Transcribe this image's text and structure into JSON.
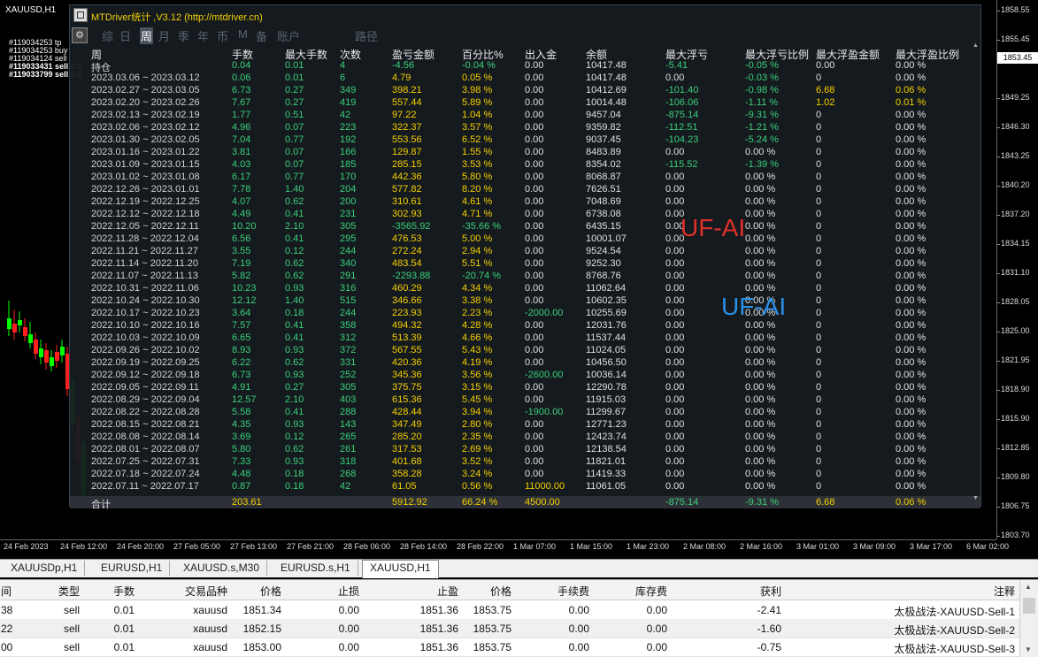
{
  "chart": {
    "symbol_label": "XAUUSD,H1",
    "trade_tags": [
      "#119034253 tp",
      "#119034253 buy",
      "#119034124 sell",
      "#119033431 sell 0.0",
      "#119033799 sell 0.0"
    ],
    "price_ticks": [
      "1858.55",
      "1855.45",
      "1852.35",
      "1849.25",
      "1846.30",
      "1843.25",
      "1840.20",
      "1837.20",
      "1834.15",
      "1831.10",
      "1828.05",
      "1825.00",
      "1821.95",
      "1818.90",
      "1815.90",
      "1812.85",
      "1809.80",
      "1806.75",
      "1803.70"
    ],
    "current_price": "1853.45",
    "time_ticks": [
      "24 Feb 2023",
      "24 Feb 12:00",
      "24 Feb 20:00",
      "27 Feb 05:00",
      "27 Feb 13:00",
      "27 Feb 21:00",
      "28 Feb 06:00",
      "28 Feb 14:00",
      "28 Feb 22:00",
      "1 Mar 07:00",
      "1 Mar 15:00",
      "1 Mar 23:00",
      "2 Mar 08:00",
      "2 Mar 16:00",
      "3 Mar 01:00",
      "3 Mar 09:00",
      "3 Mar 17:00",
      "6 Mar 02:00"
    ],
    "colors": {
      "bull": "#00ff00",
      "bear": "#ff2020",
      "background": "#000000"
    }
  },
  "chart_tabs": [
    "XAUUSDp,H1",
    "EURUSD,H1",
    "XAUUSD.s,M30",
    "EURUSD.s,H1",
    "XAUUSD,H1"
  ],
  "panel": {
    "title": "MTDriver统计 ,V3.12 (http://mtdriver.cn)",
    "settings_glyph": "⚙",
    "tabs": [
      "综",
      "日",
      "周",
      "月",
      "季",
      "年",
      "币",
      "M",
      "备",
      "账户",
      "路径"
    ],
    "active_tab": "周",
    "headers": [
      "周",
      "手数",
      "最大手数",
      "次数",
      "盈亏金额",
      "百分比%",
      "出入金",
      "余额",
      "最大浮亏",
      "最大浮亏比例",
      "最大浮盈金额",
      "最大浮盈比例"
    ],
    "position_row": [
      "持仓",
      "0.04",
      "0.01",
      "4",
      "-4.56",
      "-0.04 %",
      "0.00",
      "10417.48",
      "-5.41",
      "-0.05 %",
      "0.00",
      "0.00 %"
    ],
    "rows": [
      [
        "2023.03.06 ~ 2023.03.12",
        "0.06",
        "0.01",
        "6",
        "4.79",
        "0.05 %",
        "0.00",
        "10417.48",
        "0.00",
        "-0.03 %",
        "0",
        "0.00 %"
      ],
      [
        "2023.02.27 ~ 2023.03.05",
        "6.73",
        "0.27",
        "349",
        "398.21",
        "3.98 %",
        "0.00",
        "10412.69",
        "-101.40",
        "-0.98 %",
        "6.68",
        "0.06 %"
      ],
      [
        "2023.02.20 ~ 2023.02.26",
        "7.67",
        "0.27",
        "419",
        "557.44",
        "5.89 %",
        "0.00",
        "10014.48",
        "-106.06",
        "-1.11 %",
        "1.02",
        "0.01 %"
      ],
      [
        "2023.02.13 ~ 2023.02.19",
        "1.77",
        "0.51",
        "42",
        "97.22",
        "1.04 %",
        "0.00",
        "9457.04",
        "-875.14",
        "-9.31 %",
        "0",
        "0.00 %"
      ],
      [
        "2023.02.06 ~ 2023.02.12",
        "4.96",
        "0.07",
        "223",
        "322.37",
        "3.57 %",
        "0.00",
        "9359.82",
        "-112.51",
        "-1.21 %",
        "0",
        "0.00 %"
      ],
      [
        "2023.01.30 ~ 2023.02.05",
        "7.04",
        "0.77",
        "192",
        "553.56",
        "6.52 %",
        "0.00",
        "9037.45",
        "-104.23",
        "-5.24 %",
        "0",
        "0.00 %"
      ],
      [
        "2023.01.16 ~ 2023.01.22",
        "3.81",
        "0.07",
        "166",
        "129.87",
        "1.55 %",
        "0.00",
        "8483.89",
        "0.00",
        "0.00 %",
        "0",
        "0.00 %"
      ],
      [
        "2023.01.09 ~ 2023.01.15",
        "4.03",
        "0.07",
        "185",
        "285.15",
        "3.53 %",
        "0.00",
        "8354.02",
        "-115.52",
        "-1.39 %",
        "0",
        "0.00 %"
      ],
      [
        "2023.01.02 ~ 2023.01.08",
        "6.17",
        "0.77",
        "170",
        "442.36",
        "5.80 %",
        "0.00",
        "8068.87",
        "0.00",
        "0.00 %",
        "0",
        "0.00 %"
      ],
      [
        "2022.12.26 ~ 2023.01.01",
        "7.78",
        "1.40",
        "204",
        "577.82",
        "8.20 %",
        "0.00",
        "7626.51",
        "0.00",
        "0.00 %",
        "0",
        "0.00 %"
      ],
      [
        "2022.12.19 ~ 2022.12.25",
        "4.07",
        "0.62",
        "200",
        "310.61",
        "4.61 %",
        "0.00",
        "7048.69",
        "0.00",
        "0.00 %",
        "0",
        "0.00 %"
      ],
      [
        "2022.12.12 ~ 2022.12.18",
        "4.49",
        "0.41",
        "231",
        "302.93",
        "4.71 %",
        "0.00",
        "6738.08",
        "0.00",
        "0.00 %",
        "0",
        "0.00 %"
      ],
      [
        "2022.12.05 ~ 2022.12.11",
        "10.20",
        "2.10",
        "305",
        "-3565.92",
        "-35.66 %",
        "0.00",
        "6435.15",
        "0.00",
        "0.00 %",
        "0",
        "0.00 %"
      ],
      [
        "2022.11.28 ~ 2022.12.04",
        "6.56",
        "0.41",
        "295",
        "476.53",
        "5.00 %",
        "0.00",
        "10001.07",
        "0.00",
        "0.00 %",
        "0",
        "0.00 %"
      ],
      [
        "2022.11.21 ~ 2022.11.27",
        "3.55",
        "0.12",
        "244",
        "272.24",
        "2.94 %",
        "0.00",
        "9524.54",
        "0.00",
        "0.00 %",
        "0",
        "0.00 %"
      ],
      [
        "2022.11.14 ~ 2022.11.20",
        "7.19",
        "0.62",
        "340",
        "483.54",
        "5.51 %",
        "0.00",
        "9252.30",
        "0.00",
        "0.00 %",
        "0",
        "0.00 %"
      ],
      [
        "2022.11.07 ~ 2022.11.13",
        "5.82",
        "0.62",
        "291",
        "-2293.88",
        "-20.74 %",
        "0.00",
        "8768.76",
        "0.00",
        "0.00 %",
        "0",
        "0.00 %"
      ],
      [
        "2022.10.31 ~ 2022.11.06",
        "10.23",
        "0.93",
        "316",
        "460.29",
        "4.34 %",
        "0.00",
        "11062.64",
        "0.00",
        "0.00 %",
        "0",
        "0.00 %"
      ],
      [
        "2022.10.24 ~ 2022.10.30",
        "12.12",
        "1.40",
        "515",
        "346.66",
        "3.38 %",
        "0.00",
        "10602.35",
        "0.00",
        "0.00 %",
        "0",
        "0.00 %"
      ],
      [
        "2022.10.17 ~ 2022.10.23",
        "3.64",
        "0.18",
        "244",
        "223.93",
        "2.23 %",
        "-2000.00",
        "10255.69",
        "0.00",
        "0.00 %",
        "0",
        "0.00 %"
      ],
      [
        "2022.10.10 ~ 2022.10.16",
        "7.57",
        "0.41",
        "358",
        "494.32",
        "4.28 %",
        "0.00",
        "12031.76",
        "0.00",
        "0.00 %",
        "0",
        "0.00 %"
      ],
      [
        "2022.10.03 ~ 2022.10.09",
        "6.65",
        "0.41",
        "312",
        "513.39",
        "4.66 %",
        "0.00",
        "11537.44",
        "0.00",
        "0.00 %",
        "0",
        "0.00 %"
      ],
      [
        "2022.09.26 ~ 2022.10.02",
        "8.93",
        "0.93",
        "372",
        "567.55",
        "5.43 %",
        "0.00",
        "11024.05",
        "0.00",
        "0.00 %",
        "0",
        "0.00 %"
      ],
      [
        "2022.09.19 ~ 2022.09.25",
        "6.22",
        "0.62",
        "331",
        "420.36",
        "4.19 %",
        "0.00",
        "10456.50",
        "0.00",
        "0.00 %",
        "0",
        "0.00 %"
      ],
      [
        "2022.09.12 ~ 2022.09.18",
        "6.73",
        "0.93",
        "252",
        "345.36",
        "3.56 %",
        "-2600.00",
        "10036.14",
        "0.00",
        "0.00 %",
        "0",
        "0.00 %"
      ],
      [
        "2022.09.05 ~ 2022.09.11",
        "4.91",
        "0.27",
        "305",
        "375.75",
        "3.15 %",
        "0.00",
        "12290.78",
        "0.00",
        "0.00 %",
        "0",
        "0.00 %"
      ],
      [
        "2022.08.29 ~ 2022.09.04",
        "12.57",
        "2.10",
        "403",
        "615.36",
        "5.45 %",
        "0.00",
        "11915.03",
        "0.00",
        "0.00 %",
        "0",
        "0.00 %"
      ],
      [
        "2022.08.22 ~ 2022.08.28",
        "5.58",
        "0.41",
        "288",
        "428.44",
        "3.94 %",
        "-1900.00",
        "11299.67",
        "0.00",
        "0.00 %",
        "0",
        "0.00 %"
      ],
      [
        "2022.08.15 ~ 2022.08.21",
        "4.35",
        "0.93",
        "143",
        "347.49",
        "2.80 %",
        "0.00",
        "12771.23",
        "0.00",
        "0.00 %",
        "0",
        "0.00 %"
      ],
      [
        "2022.08.08 ~ 2022.08.14",
        "3.69",
        "0.12",
        "265",
        "285.20",
        "2.35 %",
        "0.00",
        "12423.74",
        "0.00",
        "0.00 %",
        "0",
        "0.00 %"
      ],
      [
        "2022.08.01 ~ 2022.08.07",
        "5.80",
        "0.62",
        "261",
        "317.53",
        "2.69 %",
        "0.00",
        "12138.54",
        "0.00",
        "0.00 %",
        "0",
        "0.00 %"
      ],
      [
        "2022.07.25 ~ 2022.07.31",
        "7.33",
        "0.93",
        "318",
        "401.68",
        "3.52 %",
        "0.00",
        "11821.01",
        "0.00",
        "0.00 %",
        "0",
        "0.00 %"
      ],
      [
        "2022.07.18 ~ 2022.07.24",
        "4.48",
        "0.18",
        "268",
        "358.28",
        "3.24 %",
        "0.00",
        "11419.33",
        "0.00",
        "0.00 %",
        "0",
        "0.00 %"
      ],
      [
        "2022.07.11 ~ 2022.07.17",
        "0.87",
        "0.18",
        "42",
        "61.05",
        "0.56 %",
        "11000.00",
        "11061.05",
        "0.00",
        "0.00 %",
        "0",
        "0.00 %"
      ]
    ],
    "total_row": [
      "合计",
      "203.61",
      "",
      "",
      "5912.92",
      "66.24 %",
      "4500.00",
      "",
      "-875.14",
      "-9.31 %",
      "6.68",
      "0.06 %"
    ],
    "watermarks": [
      {
        "text": "UF-AI",
        "color": "#e0302a"
      },
      {
        "text": "UF-AI",
        "color": "#2a8fe6"
      }
    ]
  },
  "terminal": {
    "headers": [
      "间",
      "类型",
      "手数",
      "交易品种",
      "价格",
      "止损",
      "止盈",
      "价格",
      "手续费",
      "库存费",
      "获利",
      "注释"
    ],
    "rows": [
      [
        "38",
        "sell",
        "0.01",
        "xauusd",
        "1851.34",
        "0.00",
        "1851.36",
        "1853.75",
        "0.00",
        "0.00",
        "-2.41",
        "太极战法-XAUUSD-Sell-1"
      ],
      [
        "22",
        "sell",
        "0.01",
        "xauusd",
        "1852.15",
        "0.00",
        "1851.36",
        "1853.75",
        "0.00",
        "0.00",
        "-1.60",
        "太极战法-XAUUSD-Sell-2"
      ],
      [
        "00",
        "sell",
        "0.01",
        "xauusd",
        "1853.00",
        "0.00",
        "1851.36",
        "1853.75",
        "0.00",
        "0.00",
        "-0.75",
        "太极战法-XAUUSD-Sell-3"
      ]
    ]
  }
}
